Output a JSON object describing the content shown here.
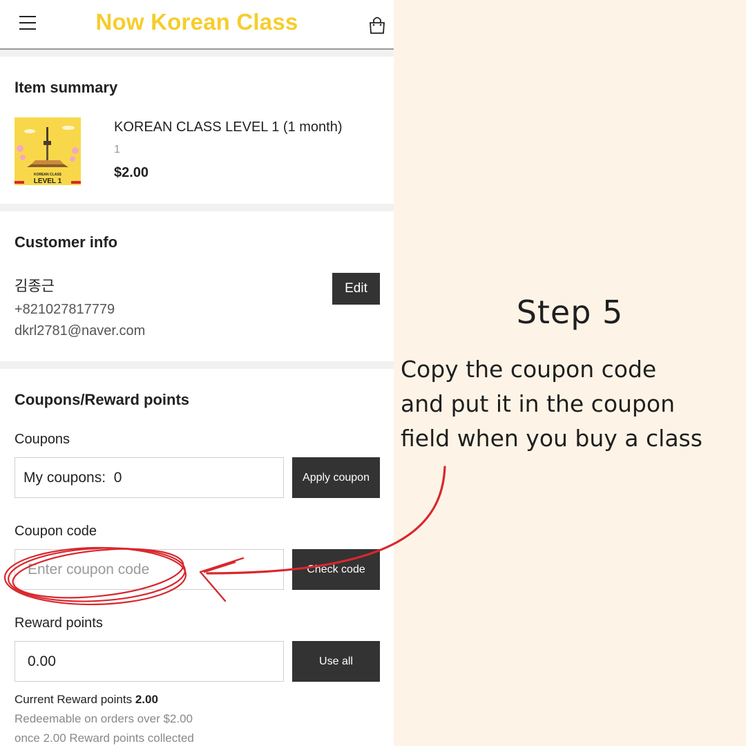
{
  "header": {
    "brand": "Now Korean Class",
    "menu_icon": "hamburger-menu-icon",
    "cart_icon": "shopping-bag-icon",
    "brand_color": "#f6cd2c"
  },
  "item_summary": {
    "title": "Item summary",
    "thumbnail": {
      "caption_small": "KOREAN CLASS",
      "caption_big": "LEVEL 1"
    },
    "name": "KOREAN CLASS LEVEL 1 (1 month)",
    "quantity": "1",
    "price": "$2.00"
  },
  "customer_info": {
    "title": "Customer info",
    "name": "김종근",
    "phone": "+821027817779",
    "email": "dkrl2781@naver.com",
    "edit_label": "Edit"
  },
  "coupons_rewards": {
    "title": "Coupons/Reward points",
    "coupons_label": "Coupons",
    "my_coupons_value": "My coupons:  0",
    "apply_coupon_label": "Apply coupon",
    "coupon_code_label": "Coupon code",
    "coupon_code_placeholder": "Enter coupon code",
    "check_code_label": "Check code",
    "reward_points_label": "Reward points",
    "reward_points_value": "0.00",
    "use_all_label": "Use all",
    "current_points_label": "Current Reward points",
    "current_points_value": "2.00",
    "redeem_note_1": "Redeemable on orders over $2.00",
    "redeem_note_2": "once 2.00 Reward points collected"
  },
  "instructions": {
    "step_title": "Step 5",
    "lines": [
      "Copy the coupon code",
      "and put it in the coupon",
      "field when you buy a class"
    ]
  },
  "colors": {
    "panel_background": "#fdf4e7",
    "button_dark": "#333333",
    "annotation_red": "#d8282d"
  }
}
